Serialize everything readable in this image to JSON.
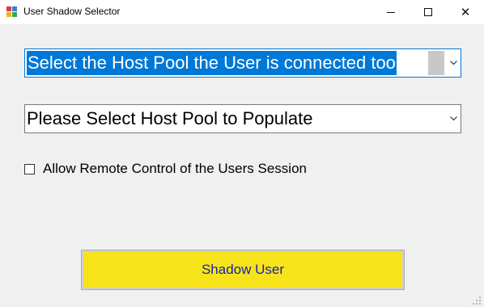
{
  "window": {
    "title": "User Shadow Selector",
    "minimize_label": "",
    "maximize_label": "",
    "close_label": "✕"
  },
  "host_pool_combo": {
    "selected_value": "Select the Host Pool the User is connected too"
  },
  "session_combo": {
    "selected_value": "Please Select Host Pool to Populate"
  },
  "remote_control": {
    "label": "Allow Remote Control of the Users Session",
    "checked": false
  },
  "shadow_button": {
    "label": "Shadow User"
  },
  "colors": {
    "button_bg": "#f7e31a",
    "button_text": "#1a22a8",
    "selection": "#0078d7",
    "window_bg": "#f0f0f0"
  },
  "icons": [
    "app-icon",
    "minimize-icon",
    "maximize-icon",
    "close-icon",
    "chevron-down-icon",
    "resize-grip-icon"
  ]
}
